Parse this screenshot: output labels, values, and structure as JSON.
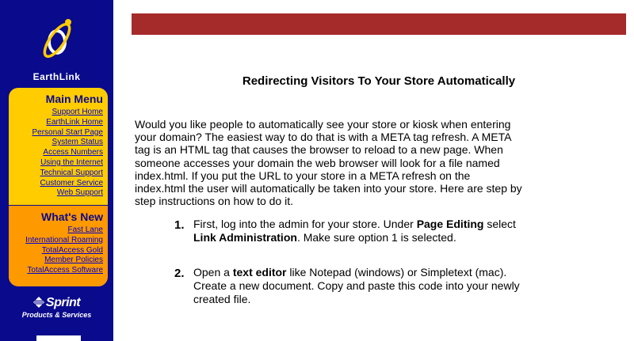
{
  "sidebar": {
    "brand": "EarthLink",
    "main_menu": {
      "title": "Main Menu",
      "links": [
        "Support Home",
        "EarthLink Home",
        "Personal Start Page",
        "System Status",
        "Access Numbers",
        "Using the Internet",
        "Technical Support",
        "Customer Service",
        "Web Support"
      ]
    },
    "whats_new": {
      "title": "What's New",
      "links": [
        "Fast Lane",
        "International Roaming",
        "TotalAccess Gold",
        "Member Policies",
        "TotalAccess Software"
      ]
    },
    "sprint": {
      "name": "Sprint",
      "tagline": "Products & Services"
    }
  },
  "colors": {
    "sidebar_bg": "#0a0a8c",
    "main_menu_bg": "#ffcc00",
    "whats_new_bg": "#ff9900",
    "header_bar": "#a52a2a",
    "link": "#0000cc"
  },
  "main": {
    "title": "Redirecting Visitors To Your Store Automatically",
    "intro": "Would you like people to automatically see your store or kiosk when entering your domain? The easiest way to do that is with a META tag refresh. A META tag is an HTML tag that causes the browser to reload to a new page. When someone accesses your domain the web browser will look for a file named index.html. If you put the URL to your store in a META refresh on the index.html the user will automatically be taken into your store. Here are step by step instructions on how to do it.",
    "steps": [
      {
        "number": "1.",
        "parts": [
          "First, log into the admin for your store. Under ",
          "Page Editing",
          " select ",
          "Link Administration",
          ". Make sure option 1 is selected."
        ]
      },
      {
        "number": "2.",
        "parts": [
          "Open a ",
          "text editor",
          " like Notepad (windows) or Simpletext (mac). Create a new document. Copy and paste this code into your newly created file."
        ]
      }
    ]
  }
}
